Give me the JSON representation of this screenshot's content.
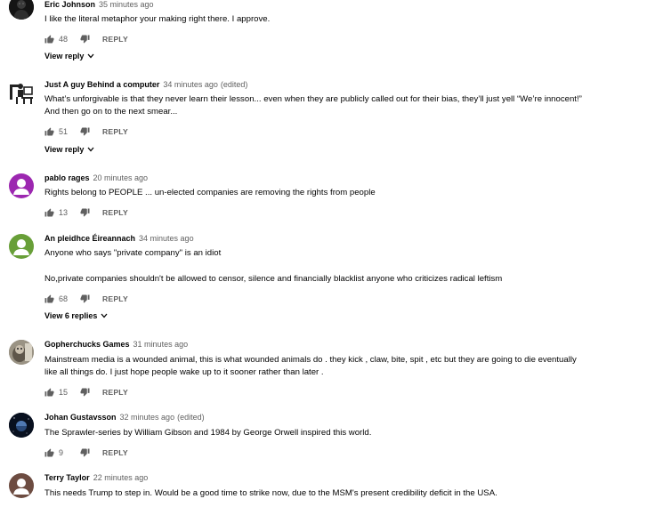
{
  "comments": [
    {
      "author": "Eric Johnson",
      "time": "35 minutes ago",
      "edited": "",
      "lines": [
        "I like the literal metaphor your making right there. I approve."
      ],
      "likes": "48",
      "reply": "REPLY",
      "view_replies": "View reply",
      "avatar_icon": "dark-figure-avatar"
    },
    {
      "author": "Just A guy Behind a computer",
      "time": "34 minutes ago",
      "edited": "(edited)",
      "lines": [
        "What’s unforgivable is that they never learn their lesson... even when they are publicly called out for their bias, they’ll just yell “We’re innocent!”",
        "And then go on to the next smear..."
      ],
      "likes": "51",
      "reply": "REPLY",
      "view_replies": "View reply",
      "avatar_icon": "person-at-computer-avatar"
    },
    {
      "author": "pablo rages",
      "time": "20 minutes ago",
      "edited": "",
      "lines": [
        "Rights belong to PEOPLE ... un-elected companies are removing the rights from people"
      ],
      "likes": "13",
      "reply": "REPLY",
      "view_replies": "",
      "avatar_icon": "default-user-avatar",
      "avatar_color": "#9c27b0"
    },
    {
      "author": "An pleidhce Éireannach",
      "time": "34 minutes ago",
      "edited": "",
      "lines": [
        "Anyone who says \"private company\" is an idiot",
        "",
        "No,private companies shouldn't be allowed to censor, silence and financially blacklist anyone who criticizes radical leftism"
      ],
      "likes": "68",
      "reply": "REPLY",
      "view_replies": "View 6 replies",
      "avatar_icon": "default-user-avatar",
      "avatar_color": "#689f38"
    },
    {
      "author": "Gopherchucks Games",
      "time": "31 minutes ago",
      "edited": "",
      "lines": [
        "Mainstream media is a wounded animal, this is what wounded animals do .  they kick , claw, bite,  spit , etc  but they are going to die eventually",
        "like all things do.  I just hope people wake up to it sooner rather than later ."
      ],
      "likes": "15",
      "reply": "REPLY",
      "view_replies": "",
      "avatar_icon": "gopher-photo-avatar"
    },
    {
      "author": "Johan Gustavsson",
      "time": "32 minutes ago",
      "edited": "(edited)",
      "lines": [
        "The Sprawler-series by William Gibson and 1984 by George Orwell inspired this world."
      ],
      "likes": "9",
      "reply": "REPLY",
      "view_replies": "",
      "avatar_icon": "space-planet-avatar"
    },
    {
      "author": "Terry Taylor",
      "time": "22 minutes ago",
      "edited": "",
      "lines": [
        "This needs Trump to step in. Would be a good time to strike now, due to the MSM's present credibility deficit in the USA."
      ],
      "likes": "",
      "reply": "",
      "view_replies": "",
      "avatar_icon": "default-user-avatar",
      "avatar_color": "#6d4c41"
    }
  ]
}
